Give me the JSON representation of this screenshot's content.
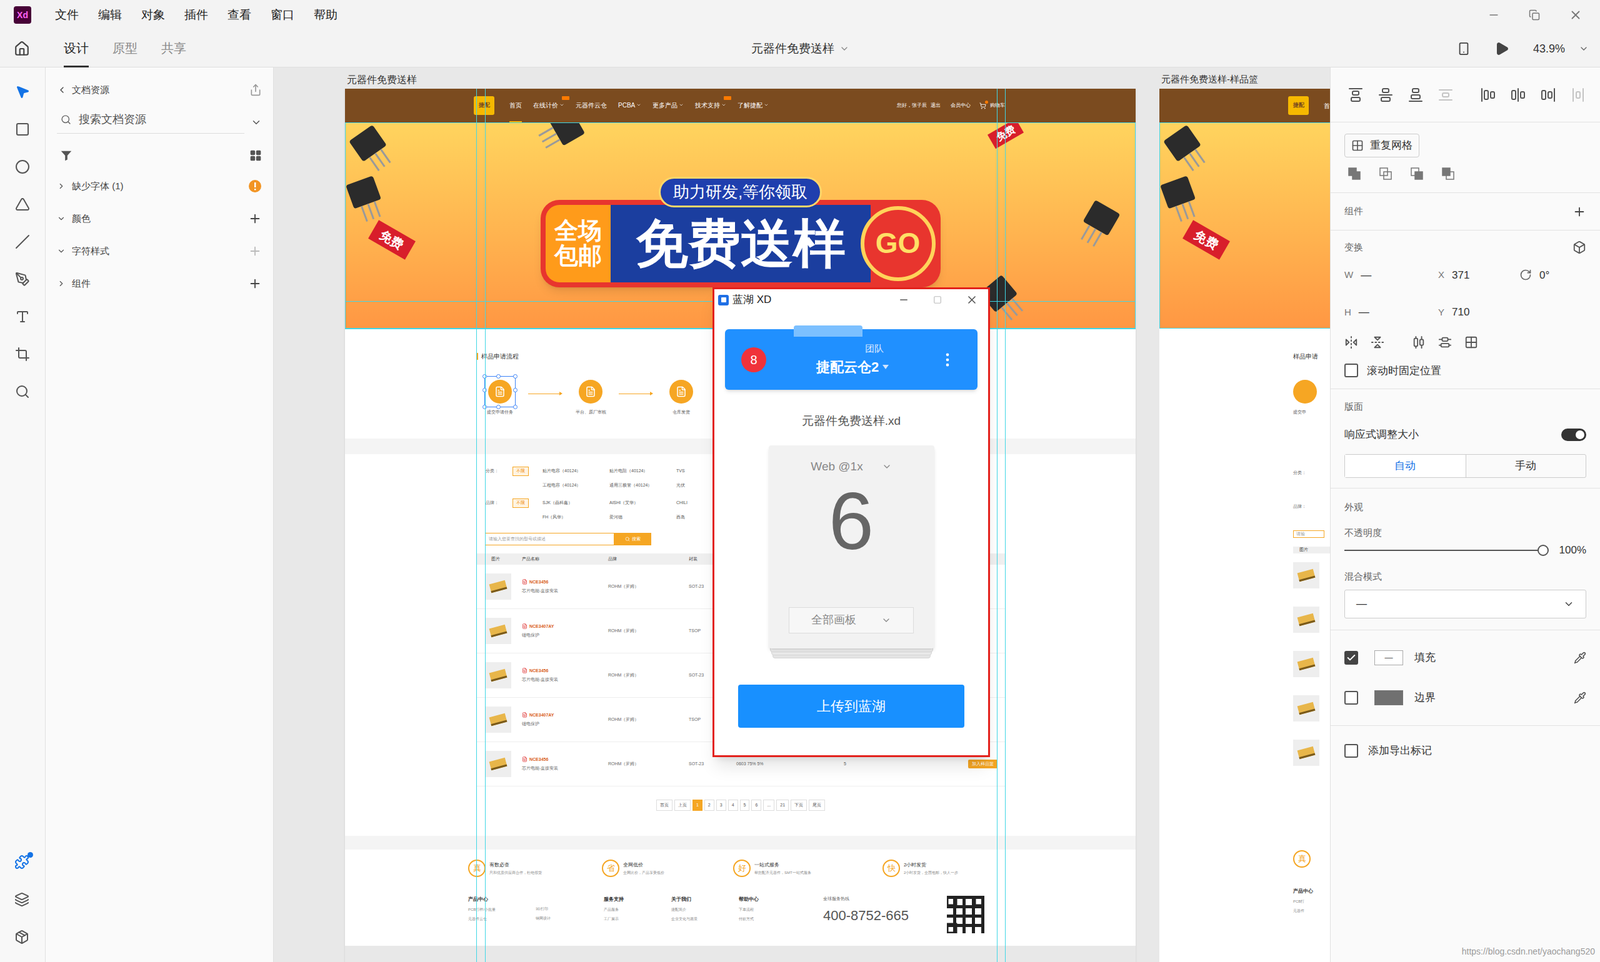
{
  "window": {
    "app_logo": "Xd",
    "menu": [
      "文件",
      "编辑",
      "对象",
      "插件",
      "查看",
      "窗口",
      "帮助"
    ]
  },
  "toolbar": {
    "tabs": [
      {
        "label": "设计",
        "selected": true
      },
      {
        "label": "原型",
        "selected": false
      },
      {
        "label": "共享",
        "selected": false
      }
    ],
    "document_title": "元器件免费送样",
    "zoom": "43.9%"
  },
  "tools": [
    {
      "kind": "select",
      "selected": true
    },
    {
      "kind": "rectangle",
      "selected": false
    },
    {
      "kind": "ellipse",
      "selected": false
    },
    {
      "kind": "polygon",
      "selected": false
    },
    {
      "kind": "line",
      "selected": false
    },
    {
      "kind": "pen",
      "selected": false
    },
    {
      "kind": "text",
      "selected": false
    },
    {
      "kind": "artboard",
      "selected": false
    },
    {
      "kind": "zoom",
      "selected": false
    }
  ],
  "rail_bottom": [
    {
      "kind": "plugins",
      "selected": true,
      "notify": true
    },
    {
      "kind": "layers",
      "selected": false,
      "notify": false
    },
    {
      "kind": "assets",
      "selected": false,
      "notify": false
    }
  ],
  "left_panel": {
    "title": "文档资源",
    "search_placeholder": "搜索文档资源",
    "sections": [
      {
        "label": "缺少字体 (1)",
        "expanded": false,
        "warning": true,
        "add": "none"
      },
      {
        "label": "颜色",
        "expanded": true,
        "warning": false,
        "add": "enabled"
      },
      {
        "label": "字符样式",
        "expanded": true,
        "warning": false,
        "add": "disabled"
      },
      {
        "label": "组件",
        "expanded": false,
        "warning": false,
        "add": "enabled"
      }
    ]
  },
  "canvas": {
    "artboards": [
      {
        "label": "元器件免费送样"
      },
      {
        "label": "元器件免费送样-样品篮"
      }
    ]
  },
  "page": {
    "logo": "捷配",
    "nav": [
      {
        "label": "首页",
        "selected": true,
        "dropdown": false,
        "badge": false
      },
      {
        "label": "在线计价",
        "selected": false,
        "dropdown": true,
        "badge": true
      },
      {
        "label": "元器件云仓",
        "selected": false,
        "dropdown": false,
        "badge": false
      },
      {
        "label": "PCBA",
        "selected": false,
        "dropdown": true,
        "badge": false
      },
      {
        "label": "更多产品",
        "selected": false,
        "dropdown": true,
        "badge": false
      },
      {
        "label": "技术支持",
        "selected": false,
        "dropdown": true,
        "badge": true
      },
      {
        "label": "了解捷配",
        "selected": false,
        "dropdown": true,
        "badge": false
      }
    ],
    "user": {
      "greeting": "您好，张子辰",
      "logout": "退出",
      "member": "会员中心",
      "cart": "购物车"
    },
    "banner": {
      "top": "助力研发,等你领取",
      "left_lines": [
        "全场",
        "包邮"
      ],
      "main": "免费送样",
      "go": "GO",
      "ribbon": "免费",
      "corner": "免费"
    },
    "steps": {
      "title": "样品申请流程",
      "items": [
        {
          "label": "提交申请任务",
          "selected": true
        },
        {
          "label": "平台、原厂审核",
          "selected": false
        },
        {
          "label": "仓库发货",
          "selected": false
        }
      ]
    },
    "filters": [
      {
        "label": "分类：",
        "all": "不限",
        "options": [
          "贴片电容（40124）",
          "贴片电阻（40124）",
          "TVS",
          "工程电容（40124）",
          "通用三极管（40124）",
          "光伏"
        ]
      },
      {
        "label": "品牌：",
        "all": "不限",
        "options": [
          "SJK（晶科鑫）",
          "AISHI（艾华）",
          "CHILI",
          "FH（风华）",
          "爱河德",
          "西岛"
        ]
      }
    ],
    "search": {
      "placeholder": "请输入您要查找的型号或描述",
      "button": "搜索"
    },
    "table": {
      "columns": [
        "图片",
        "产品名称",
        "品牌",
        "封装"
      ],
      "rows": [
        {
          "name": "NCE3456",
          "desc": "芯片电能-直接安装",
          "brand": "ROHM（罗姆）",
          "package": "SOT-23",
          "spec": "",
          "qty": "",
          "button": ""
        },
        {
          "name": "NCE3407AY",
          "desc": "锂电保护",
          "brand": "ROHM（罗姆）",
          "package": "TSOP",
          "spec": "",
          "qty": "",
          "button": ""
        },
        {
          "name": "NCE3456",
          "desc": "芯片电能-直接安装",
          "brand": "ROHM（罗姆）",
          "package": "SOT-23",
          "spec": "",
          "qty": "",
          "button": ""
        },
        {
          "name": "NCE3407AY",
          "desc": "锂电保护",
          "brand": "ROHM（罗姆）",
          "package": "TSOP",
          "spec": "",
          "qty": "",
          "button": ""
        },
        {
          "name": "NCE3456",
          "desc": "芯片电能-直接安装",
          "brand": "ROHM（罗姆）",
          "package": "SOT-23",
          "spec": "0603 75% 5%",
          "qty": "5",
          "button": "加入样品篮"
        }
      ]
    },
    "pagination": [
      {
        "label": "首页",
        "selected": false
      },
      {
        "label": "上页",
        "selected": false
      },
      {
        "label": "1",
        "selected": true
      },
      {
        "label": "2",
        "selected": false
      },
      {
        "label": "3",
        "selected": false
      },
      {
        "label": "4",
        "selected": false
      },
      {
        "label": "5",
        "selected": false
      },
      {
        "label": "6",
        "selected": false
      },
      {
        "label": "...",
        "selected": false
      },
      {
        "label": "21",
        "selected": false
      },
      {
        "label": "下页",
        "selected": false
      },
      {
        "label": "尾页",
        "selected": false
      }
    ],
    "services": [
      {
        "icon": "真",
        "title": "有数必查",
        "desc": "只和优质供应商合作，杜绝假货"
      },
      {
        "icon": "省",
        "title": "全网低价",
        "desc": "全网比价，产品享受低价"
      },
      {
        "icon": "好",
        "title": "一站式服务",
        "desc": "帮您配齐元器件，SMT一站式服务"
      },
      {
        "icon": "快",
        "title": "2小时发货",
        "desc": "2小时发货，全国包邮，快人一步"
      }
    ],
    "footer_columns": [
      {
        "title": "产品中心",
        "links": [
          "PCB打样/小批量",
          "元器件云仓"
        ]
      },
      {
        "title": "",
        "links": [
          "3D打印",
          "钢网设计"
        ]
      },
      {
        "title": "服务支持",
        "links": [
          "产品服务",
          "工厂展示"
        ]
      },
      {
        "title": "关于我们",
        "links": [
          "捷配简介",
          "企业文化与愿景"
        ]
      },
      {
        "title": "帮助中心",
        "links": [
          "下单流程",
          "付款方式"
        ]
      }
    ],
    "hotline": {
      "label": "全球服务热线",
      "number": "400-8752-665"
    }
  },
  "artboard2": {
    "logo": "捷配",
    "nav_cut": "首",
    "ribbon": "免费",
    "steps_title": "样品申请",
    "step_label": "提交申",
    "filter_labels": [
      "分类：",
      "品牌："
    ],
    "search_cut": "请输",
    "table_header": "图片",
    "footer_icon": "真",
    "footer_title": "产品中心",
    "footer_links": [
      "PCB打",
      "元器件"
    ]
  },
  "plugin_dialog": {
    "title": "蓝湖 XD",
    "team_count": "8",
    "team_label": "团队",
    "team_name": "捷配云仓2",
    "file": "元器件免费送样.xd",
    "device": "Web @1x",
    "artboard_count": "6",
    "scope": "全部画板",
    "upload": "上传到蓝湖"
  },
  "right_panel": {
    "align": [
      {
        "kind": "top",
        "disabled": false
      },
      {
        "kind": "middle",
        "disabled": false
      },
      {
        "kind": "bottom",
        "disabled": false
      },
      {
        "kind": "distribute-v",
        "disabled": true
      },
      {
        "kind": "left",
        "disabled": false
      },
      {
        "kind": "center",
        "disabled": false
      },
      {
        "kind": "right",
        "disabled": false
      },
      {
        "kind": "distribute-h",
        "disabled": true
      }
    ],
    "repeat_grid": "重复网格",
    "component": "组件",
    "transform": {
      "title": "变换",
      "w_label": "W",
      "w": "—",
      "h_label": "H",
      "h": "—",
      "x_label": "X",
      "x": "371",
      "y_label": "Y",
      "y": "710",
      "rotation": "0°"
    },
    "fixed_position": {
      "label": "滚动时固定位置",
      "checked": false
    },
    "layout": {
      "title": "版面",
      "responsive": {
        "label": "响应式调整大小",
        "on": true
      },
      "modes": [
        {
          "label": "自动",
          "selected": true
        },
        {
          "label": "手动",
          "selected": false
        }
      ]
    },
    "appearance": {
      "title": "外观",
      "opacity": {
        "label": "不透明度",
        "level": 1,
        "reading": "100%"
      },
      "blend": {
        "label": "混合模式",
        "value": "—"
      }
    },
    "fill": {
      "label": "填充",
      "checked": true,
      "swatch": "—"
    },
    "border": {
      "label": "边界",
      "checked": false
    },
    "export": {
      "label": "添加导出标记",
      "checked": false
    }
  },
  "watermark": "https://blog.csdn.net/yaochang520"
}
